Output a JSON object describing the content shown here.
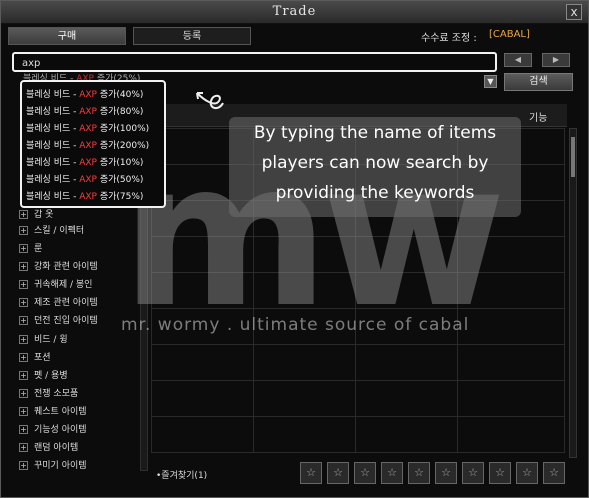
{
  "window": {
    "title": "Trade",
    "close_glyph": "x"
  },
  "tabs": [
    {
      "label": "구매"
    },
    {
      "label": "등록"
    }
  ],
  "fee": {
    "label": "수수료 조정 :",
    "value": "[CABAL]"
  },
  "search": {
    "value": "axp"
  },
  "pager": {
    "prev_glyph": "◀",
    "next_glyph": "▶"
  },
  "search_button": {
    "label": "검색"
  },
  "dropdown_glyph": "▼",
  "column_header": {
    "label": "기능"
  },
  "suggestion_partial": {
    "prefix": "블레싱 비드 - ",
    "highlight": "AXP",
    "suffix": " 증가(25%)"
  },
  "suggestions": [
    {
      "prefix": "블레싱 비드 - ",
      "highlight": "AXP",
      "suffix": " 증가(40%)"
    },
    {
      "prefix": "블레싱 비드 - ",
      "highlight": "AXP",
      "suffix": " 증가(80%)"
    },
    {
      "prefix": "블레싱 비드 - ",
      "highlight": "AXP",
      "suffix": " 증가(100%)"
    },
    {
      "prefix": "블레싱 비드 - ",
      "highlight": "AXP",
      "suffix": " 증가(200%)"
    },
    {
      "prefix": "블레싱 비드 - ",
      "highlight": "AXP",
      "suffix": " 증가(10%)"
    },
    {
      "prefix": "블레싱 비드 - ",
      "highlight": "AXP",
      "suffix": " 증가(50%)"
    },
    {
      "prefix": "블레싱 비드 - ",
      "highlight": "AXP",
      "suffix": " 증가(75%)"
    }
  ],
  "categories": [
    {
      "label": "갑 옷"
    },
    {
      "label": "스킬 / 이펙터"
    },
    {
      "label": "룬"
    },
    {
      "label": "강화 관련 아이템"
    },
    {
      "label": "귀속해제 / 봉인"
    },
    {
      "label": "제조 관련 아이템"
    },
    {
      "label": "던전 진입 아이템"
    },
    {
      "label": "비드 / 윙"
    },
    {
      "label": "포션"
    },
    {
      "label": "펫 / 용병"
    },
    {
      "label": "전쟁 소모품"
    },
    {
      "label": "퀘스트 아이템"
    },
    {
      "label": "기능성 아이템"
    },
    {
      "label": "랜덤 아이템"
    },
    {
      "label": "꾸미기 아이템"
    }
  ],
  "callout": {
    "lines": [
      "By typing the name of items",
      "players can now search by",
      "providing the keywords"
    ]
  },
  "watermark": {
    "logo": "mw",
    "tagline": "mr. wormy . ultimate source of cabal"
  },
  "favorites": {
    "label": "•즐겨찾기(1)"
  },
  "slots": [
    "☆",
    "☆",
    "☆",
    "☆",
    "☆",
    "☆",
    "☆",
    "☆",
    "☆",
    "☆"
  ],
  "colors": {
    "accent": "#e8a642",
    "highlight": "#ff3b3b"
  }
}
